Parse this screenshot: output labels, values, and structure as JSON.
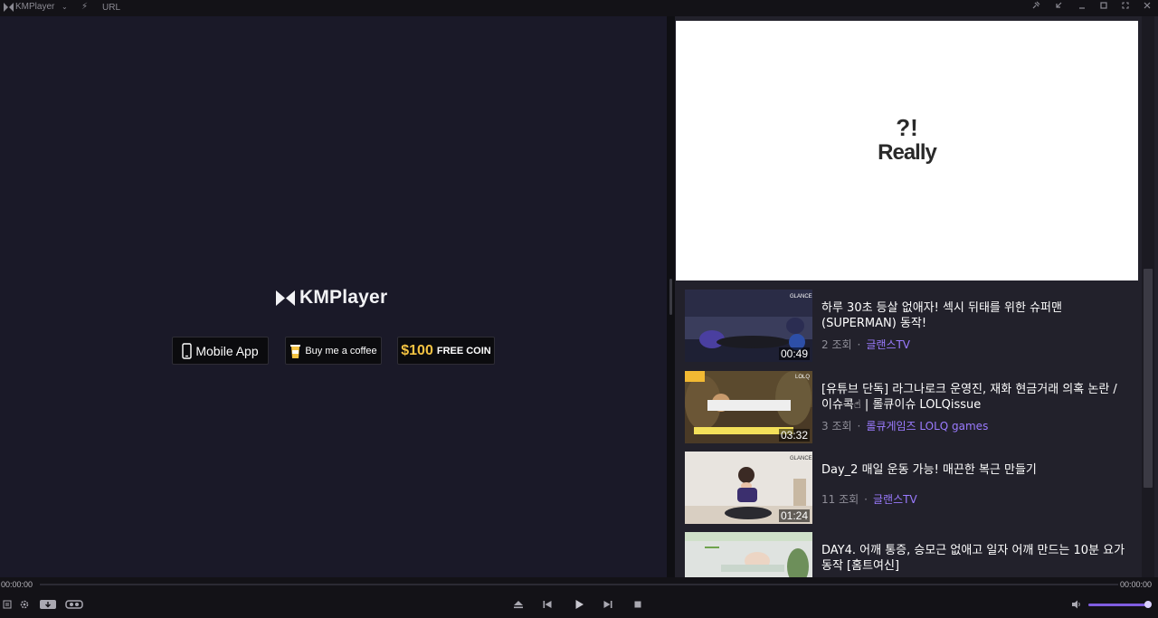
{
  "titlebar": {
    "app_name": "KMPlayer",
    "url_label": "URL",
    "caret": "⌄",
    "bolt": "⚡",
    "buttons": [
      "pin-icon",
      "mini-mode-icon",
      "minimize-icon",
      "maximize-icon",
      "fullscreen-icon",
      "close-icon"
    ]
  },
  "video_area": {
    "brand_text": "KMPlayer",
    "promo": {
      "mobile_app": "Mobile App",
      "coffee": "Buy me a coffee",
      "coin_amount": "$100",
      "coin_text": "FREE COIN"
    }
  },
  "panel": {
    "banner": {
      "line1": "?!",
      "line2": "Really"
    },
    "videos": [
      {
        "title": "하루 30초 등살 없애자! 섹시 뒤태를 위한 슈퍼맨 (SUPERMAN) 동작!",
        "views": "2 조회",
        "channel": "글랜스TV",
        "duration": "00:49",
        "thumb_text": "GLANCE"
      },
      {
        "title": "[유튜브 단독] 라그나로크 운영진, 재화 현금거래 의혹 논란 / 이슈콕☝ | 롤큐이슈 LOLQissue",
        "views": "3 조회",
        "channel": "롤큐게임즈 LOLQ games",
        "duration": "03:32",
        "thumb_text": "LOLQ"
      },
      {
        "title": "Day_2 매일 운동 가능! 매끈한 복근 만들기",
        "views": "11 조회",
        "channel": "글랜스TV",
        "duration": "01:24",
        "thumb_text": "GLANCE"
      },
      {
        "title": "DAY4. 어깨 통증, 승모근 없애고 일자 어깨 만드는 10분 요가 동작 [홈트여신]",
        "views": "",
        "channel": "",
        "duration": "",
        "thumb_text": ""
      }
    ],
    "meta_separator": "·"
  },
  "seekbar": {
    "elapsed": "00:00:00",
    "total": "00:00:00",
    "progress": 0
  },
  "controls": {
    "left": [
      "playlist-icon",
      "settings-icon",
      "download-icon",
      "vr-icon"
    ],
    "center": [
      "eject-icon",
      "previous-icon",
      "play-icon",
      "next-icon",
      "stop-icon"
    ],
    "volume_level": 1.0
  },
  "colors": {
    "accent": "#7f5de0",
    "channel_link": "#9b7bff",
    "background": "#19181f"
  }
}
